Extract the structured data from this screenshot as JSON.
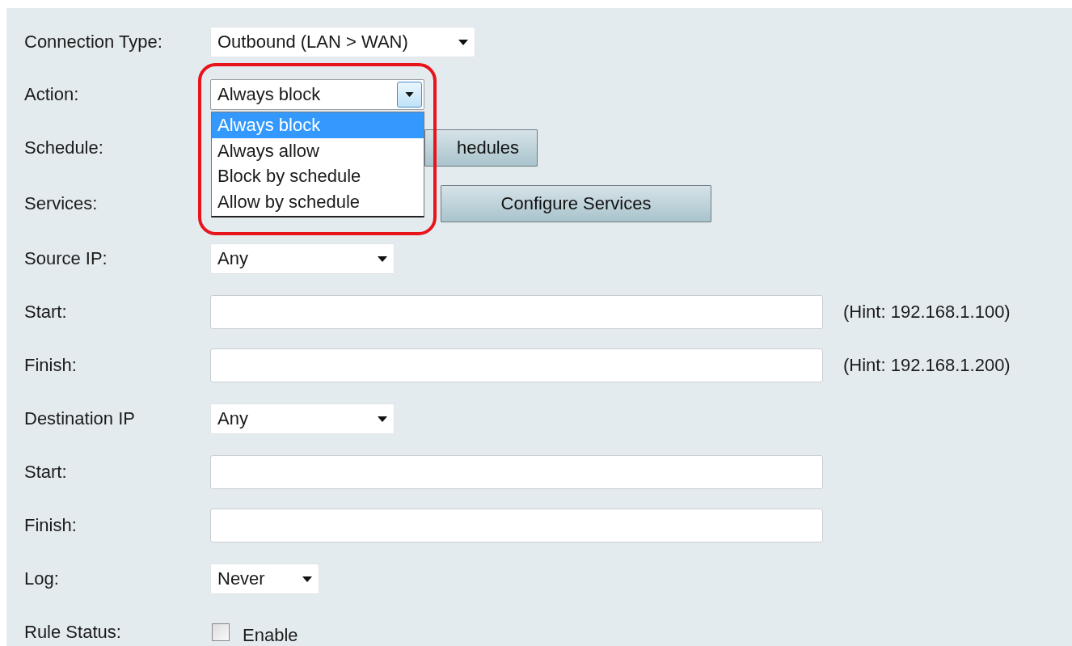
{
  "fields": [
    {
      "kind": "select",
      "label": "Connection Type:",
      "value": "Outbound (LAN > WAN)"
    },
    {
      "kind": "select",
      "label": "Action:",
      "value": "Always block",
      "open": true,
      "options": [
        {
          "text": "Always block",
          "selected": true
        },
        {
          "text": "Always allow",
          "selected": false
        },
        {
          "text": "Block by schedule",
          "selected": false
        },
        {
          "text": "Allow by schedule",
          "selected": false
        }
      ]
    },
    {
      "kind": "button",
      "label": "Schedule:",
      "button": "hedules"
    },
    {
      "kind": "button",
      "label": "Services:",
      "button": "Configure Services"
    },
    {
      "kind": "select",
      "label": "Source IP:",
      "value": "Any"
    },
    {
      "kind": "input",
      "label": "Start:",
      "hint": "(Hint: 192.168.1.100)"
    },
    {
      "kind": "input",
      "label": "Finish:",
      "hint": "(Hint: 192.168.1.200)"
    },
    {
      "kind": "select",
      "label": "Destination IP",
      "value": "Any"
    },
    {
      "kind": "input",
      "label": "Start:"
    },
    {
      "kind": "input",
      "label": "Finish:"
    },
    {
      "kind": "select",
      "label": "Log:",
      "value": "Never"
    },
    {
      "kind": "checkbox",
      "label": "Rule Status:",
      "checked": false,
      "text": "Enable"
    }
  ]
}
